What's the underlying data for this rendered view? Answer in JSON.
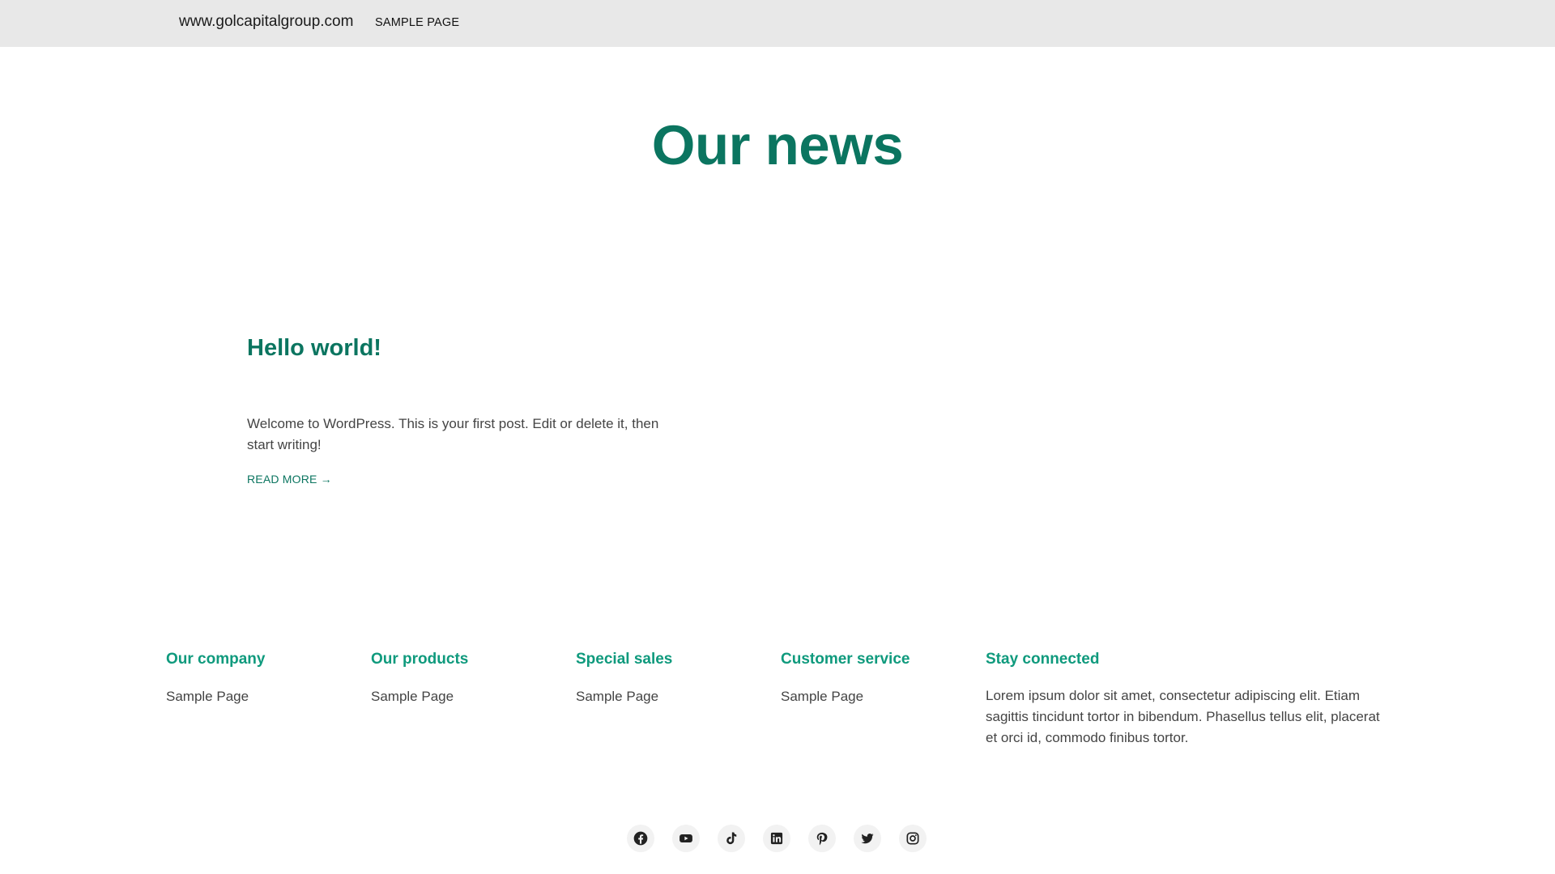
{
  "header": {
    "site_title": "www.golcapitalgroup.com",
    "nav": [
      {
        "label": "SAMPLE PAGE"
      }
    ]
  },
  "main": {
    "page_title": "Our news",
    "posts": [
      {
        "title": "Hello world!",
        "excerpt": "Welcome to WordPress. This is your first post. Edit or delete it, then start writing!",
        "read_more": "READ MORE →"
      }
    ]
  },
  "footer": {
    "columns": [
      {
        "heading": "Our company",
        "link": "Sample Page"
      },
      {
        "heading": "Our products",
        "link": "Sample Page"
      },
      {
        "heading": "Special sales",
        "link": "Sample Page"
      },
      {
        "heading": "Customer service",
        "link": "Sample Page"
      }
    ],
    "stay_connected": {
      "heading": "Stay connected",
      "text": "Lorem ipsum dolor sit amet, consectetur adipiscing elit. Etiam sagittis tincidunt tortor in bibendum. Phasellus tellus elit, placerat et orci id, commodo finibus tortor."
    },
    "social_icons": [
      "facebook-icon",
      "youtube-icon",
      "tiktok-icon",
      "linkedin-icon",
      "pinterest-icon",
      "twitter-icon",
      "instagram-icon"
    ]
  },
  "colors": {
    "accent": "#0b7560",
    "footer_heading": "#0f9a7d",
    "topbar_bg": "#e8e8e8",
    "body_text": "#444444"
  }
}
